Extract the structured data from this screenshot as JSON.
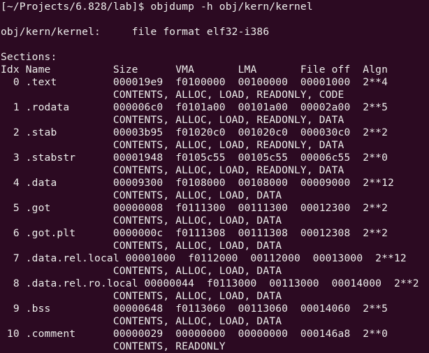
{
  "terminal": {
    "prompt": "[~/Projects/6.828/lab]$ ",
    "command": "objdump -h obj/kern/kernel",
    "file_header": "obj/kern/kernel:     file format elf32-i386",
    "sections_label": "Sections:",
    "columns": [
      "Idx",
      "Name",
      "Size",
      "VMA",
      "LMA",
      "File off",
      "Algn"
    ],
    "header_line": "Idx Name          Size      VMA       LMA       File off  Algn",
    "sections": [
      {
        "idx": "0",
        "name": ".text",
        "size": "000019e9",
        "vma": "f0100000",
        "lma": "00100000",
        "file_off": "00001000",
        "algn": "2**4",
        "flags": "CONTENTS, ALLOC, LOAD, READONLY, CODE",
        "line": "  0 .text         000019e9  f0100000  00100000  00001000  2**4",
        "flags_line": "                  CONTENTS, ALLOC, LOAD, READONLY, CODE"
      },
      {
        "idx": "1",
        "name": ".rodata",
        "size": "000006c0",
        "vma": "f0101a00",
        "lma": "00101a00",
        "file_off": "00002a00",
        "algn": "2**5",
        "flags": "CONTENTS, ALLOC, LOAD, READONLY, DATA",
        "line": "  1 .rodata       000006c0  f0101a00  00101a00  00002a00  2**5",
        "flags_line": "                  CONTENTS, ALLOC, LOAD, READONLY, DATA"
      },
      {
        "idx": "2",
        "name": ".stab",
        "size": "00003b95",
        "vma": "f01020c0",
        "lma": "001020c0",
        "file_off": "000030c0",
        "algn": "2**2",
        "flags": "CONTENTS, ALLOC, LOAD, READONLY, DATA",
        "line": "  2 .stab         00003b95  f01020c0  001020c0  000030c0  2**2",
        "flags_line": "                  CONTENTS, ALLOC, LOAD, READONLY, DATA"
      },
      {
        "idx": "3",
        "name": ".stabstr",
        "size": "00001948",
        "vma": "f0105c55",
        "lma": "00105c55",
        "file_off": "00006c55",
        "algn": "2**0",
        "flags": "CONTENTS, ALLOC, LOAD, READONLY, DATA",
        "line": "  3 .stabstr      00001948  f0105c55  00105c55  00006c55  2**0",
        "flags_line": "                  CONTENTS, ALLOC, LOAD, READONLY, DATA"
      },
      {
        "idx": "4",
        "name": ".data",
        "size": "00009300",
        "vma": "f0108000",
        "lma": "00108000",
        "file_off": "00009000",
        "algn": "2**12",
        "flags": "CONTENTS, ALLOC, LOAD, DATA",
        "line": "  4 .data         00009300  f0108000  00108000  00009000  2**12",
        "flags_line": "                  CONTENTS, ALLOC, LOAD, DATA"
      },
      {
        "idx": "5",
        "name": ".got",
        "size": "00000008",
        "vma": "f0111300",
        "lma": "00111300",
        "file_off": "00012300",
        "algn": "2**2",
        "flags": "CONTENTS, ALLOC, LOAD, DATA",
        "line": "  5 .got          00000008  f0111300  00111300  00012300  2**2",
        "flags_line": "                  CONTENTS, ALLOC, LOAD, DATA"
      },
      {
        "idx": "6",
        "name": ".got.plt",
        "size": "0000000c",
        "vma": "f0111308",
        "lma": "00111308",
        "file_off": "00012308",
        "algn": "2**2",
        "flags": "CONTENTS, ALLOC, LOAD, DATA",
        "line": "  6 .got.plt      0000000c  f0111308  00111308  00012308  2**2",
        "flags_line": "                  CONTENTS, ALLOC, LOAD, DATA"
      },
      {
        "idx": "7",
        "name": ".data.rel.local",
        "size": "00001000",
        "vma": "f0112000",
        "lma": "00112000",
        "file_off": "00013000",
        "algn": "2**12",
        "flags": "CONTENTS, ALLOC, LOAD, DATA",
        "line": "  7 .data.rel.local 00001000  f0112000  00112000  00013000  2**12",
        "flags_line": "                  CONTENTS, ALLOC, LOAD, DATA"
      },
      {
        "idx": "8",
        "name": ".data.rel.ro.local",
        "size": "00000044",
        "vma": "f0113000",
        "lma": "00113000",
        "file_off": "00014000",
        "algn": "2**2",
        "flags": "CONTENTS, ALLOC, LOAD, DATA",
        "line": "  8 .data.rel.ro.local 00000044  f0113000  00113000  00014000  2**2",
        "flags_line": "                  CONTENTS, ALLOC, LOAD, DATA"
      },
      {
        "idx": "9",
        "name": ".bss",
        "size": "00000648",
        "vma": "f0113060",
        "lma": "00113060",
        "file_off": "00014060",
        "algn": "2**5",
        "flags": "CONTENTS, ALLOC, LOAD, DATA",
        "line": "  9 .bss          00000648  f0113060  00113060  00014060  2**5",
        "flags_line": "                  CONTENTS, ALLOC, LOAD, DATA"
      },
      {
        "idx": "10",
        "name": ".comment",
        "size": "00000029",
        "vma": "00000000",
        "lma": "00000000",
        "file_off": "000146a8",
        "algn": "2**0",
        "flags": "CONTENTS, READONLY",
        "line": " 10 .comment      00000029  00000000  00000000  000146a8  2**0",
        "flags_line": "                  CONTENTS, READONLY"
      }
    ]
  },
  "colors": {
    "background": "#2c0a22",
    "foreground": "#eeeeec"
  }
}
